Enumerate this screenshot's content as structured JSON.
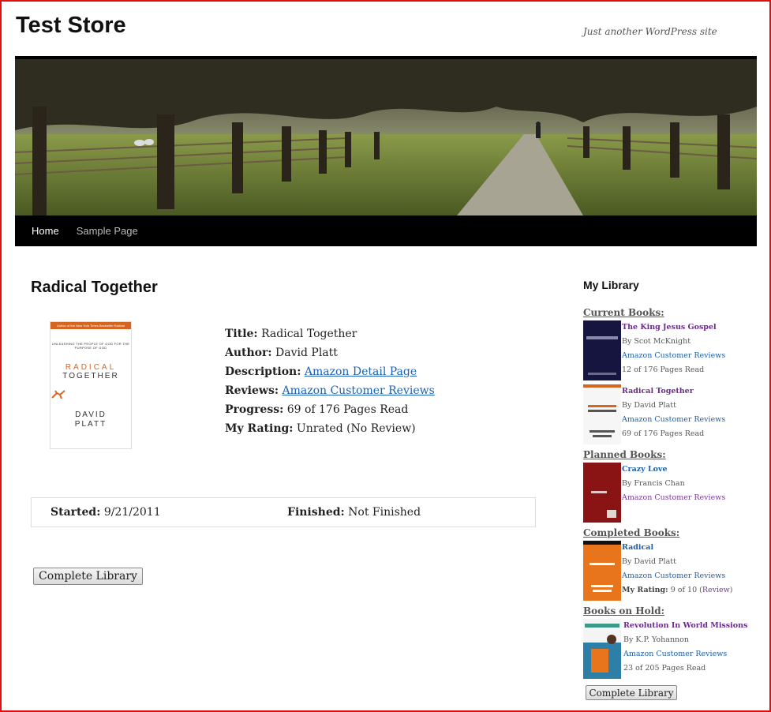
{
  "site": {
    "title": "Test Store",
    "tagline": "Just another WordPress site"
  },
  "nav": {
    "items": [
      "Home",
      "Sample Page"
    ]
  },
  "book": {
    "title": "Radical Together",
    "cover": {
      "banner": "Author of the New York Times Bestseller Radical",
      "subtitle": "UNLEASHING THE PEOPLE OF GOD FOR THE PURPOSE OF GOD",
      "word1": "RADICAL",
      "word2": "TOGETHER",
      "author_line1": "DAVID",
      "author_line2": "PLATT"
    },
    "fields": {
      "title_label": "Title:",
      "title_value": "Radical Together",
      "author_label": "Author:",
      "author_value": "David Platt",
      "description_label": "Description:",
      "description_link": "Amazon Detail Page",
      "reviews_label": "Reviews:",
      "reviews_link": "Amazon Customer Reviews",
      "progress_label": "Progress:",
      "progress_value": "69 of 176 Pages Read",
      "rating_label": "My Rating:",
      "rating_value": "Unrated (No Review)"
    },
    "dates": {
      "started_label": "Started:",
      "started_value": "9/21/2011",
      "finished_label": "Finished:",
      "finished_value": "Not Finished"
    },
    "complete_library_button": "Complete Library"
  },
  "sidebar": {
    "title": "My Library",
    "current": {
      "heading": "Current Books:",
      "books": [
        {
          "title": "The King Jesus Gospel",
          "by": "By Scot McKnight",
          "reviews": "Amazon Customer Reviews",
          "progress": "12 of 176 Pages Read"
        },
        {
          "title": "Radical Together",
          "by": "By David Platt",
          "reviews": "Amazon Customer Reviews",
          "progress": "69 of 176 Pages Read"
        }
      ]
    },
    "planned": {
      "heading": "Planned Books:",
      "books": [
        {
          "title": "Crazy Love",
          "by": "By Francis Chan",
          "reviews": "Amazon Customer Reviews"
        }
      ]
    },
    "completed": {
      "heading": "Completed Books:",
      "books": [
        {
          "title": "Radical",
          "by": "By David Platt",
          "reviews": "Amazon Customer Reviews",
          "rating_label": "My Rating:",
          "rating_value": "9 of 10",
          "review_link": "Review"
        }
      ]
    },
    "hold": {
      "heading": "Books on Hold:",
      "books": [
        {
          "title": "Revolution In World Missions",
          "by": "By K.P. Yohannon",
          "reviews": "Amazon Customer Reviews",
          "progress": "23 of 205 Pages Read"
        }
      ]
    },
    "complete_library_button": "Complete Library"
  }
}
